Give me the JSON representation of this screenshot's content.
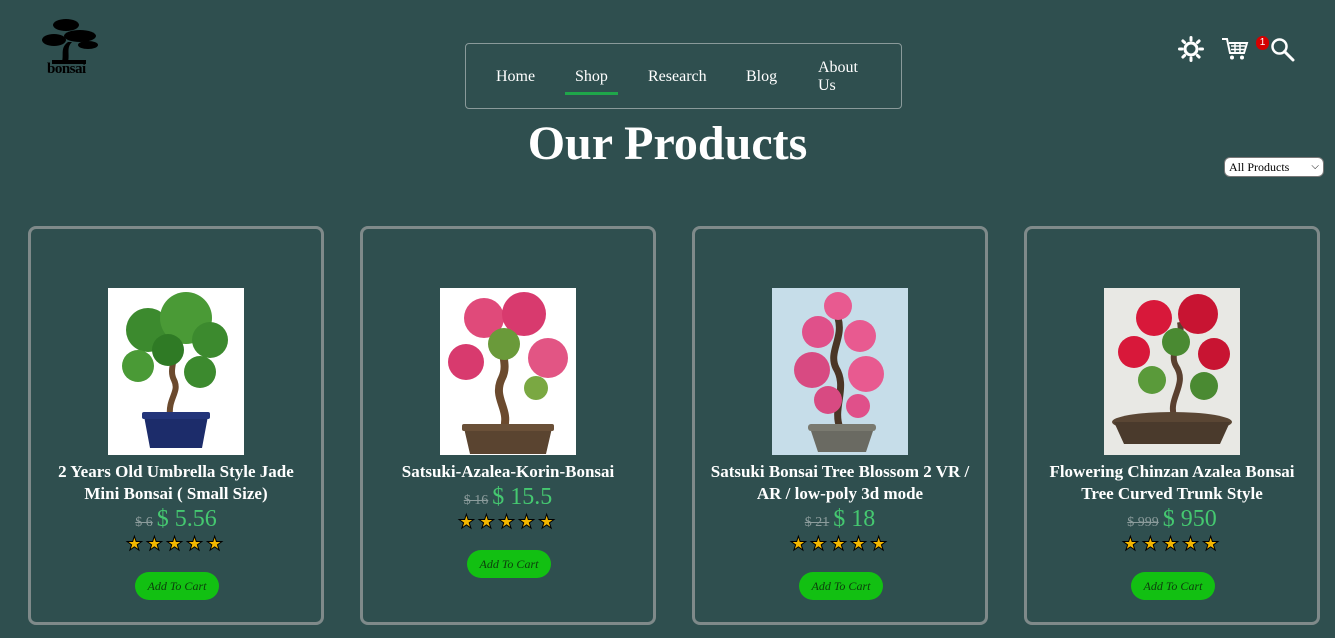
{
  "brand": {
    "logo_text": "bonsai"
  },
  "nav": {
    "items": [
      {
        "label": "Home",
        "active": false
      },
      {
        "label": "Shop",
        "active": true
      },
      {
        "label": "Research",
        "active": false
      },
      {
        "label": "Blog",
        "active": false
      },
      {
        "label": "About Us",
        "active": false
      }
    ]
  },
  "header_icons": {
    "theme_icon": "sun-icon",
    "cart_icon": "cart-icon",
    "cart_count": "1",
    "search_icon": "search-icon"
  },
  "page": {
    "title": "Our Products"
  },
  "filter": {
    "selected": "All Products"
  },
  "products": [
    {
      "name": "2 Years Old Umbrella Style Jade Mini Bonsai ( Small Size)",
      "old_price": "$ 6",
      "price": "$ 5.56",
      "rating": 5,
      "button": "Add To Cart"
    },
    {
      "name": "Satsuki-Azalea-Korin-Bonsai",
      "old_price": "$ 16",
      "price": "$ 15.5",
      "rating": 5,
      "button": "Add To Cart"
    },
    {
      "name": "Satsuki Bonsai Tree Blossom 2 VR / AR / low-poly 3d mode",
      "old_price": "$ 21",
      "price": "$ 18",
      "rating": 5,
      "button": "Add To Cart"
    },
    {
      "name": "Flowering Chinzan Azalea Bonsai Tree Curved Trunk Style",
      "old_price": "$ 999",
      "price": "$ 950",
      "rating": 5,
      "button": "Add To Cart"
    }
  ],
  "colors": {
    "background": "#2f4f4f",
    "accent": "#1fa64a",
    "price": "#45c870",
    "button": "#12c012",
    "badge": "#d40000",
    "star": "#f5b800"
  }
}
